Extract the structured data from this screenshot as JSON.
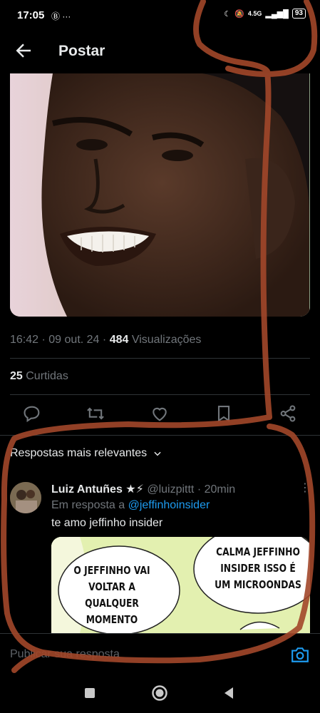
{
  "status_bar": {
    "time": "17:05",
    "left_icons": "Ⓑ ···",
    "network": "4.5G",
    "battery": "93"
  },
  "header": {
    "title": "Postar"
  },
  "post": {
    "time": "16:42",
    "date": "09 out. 24",
    "views_count": "484",
    "views_label": "Visualizações",
    "likes_count": "25",
    "likes_label": "Curtidas"
  },
  "replies": {
    "sort_label": "Respostas mais relevantes",
    "items": [
      {
        "name": "Luiz Antuñes ★⚡",
        "handle": "@luizpittt",
        "age": "20min",
        "reply_prefix": "Em resposta a",
        "reply_to": "@jeffinhoinsider",
        "text": "te amo jeffinho insider",
        "image_bubble_left": "O JEFFINHO VAI VOLTAR A QUALQUER MOMENTO",
        "image_bubble_right": "CALMA JEFFINHO INSIDER ISSO É UM MICROONDAS"
      }
    ]
  },
  "compose": {
    "placeholder": "Publicar sua resposta"
  },
  "colors": {
    "background": "#000000",
    "text": "#e7e9ea",
    "muted": "#71767b",
    "link": "#1d9bf0",
    "annotation": "#a2472a"
  }
}
